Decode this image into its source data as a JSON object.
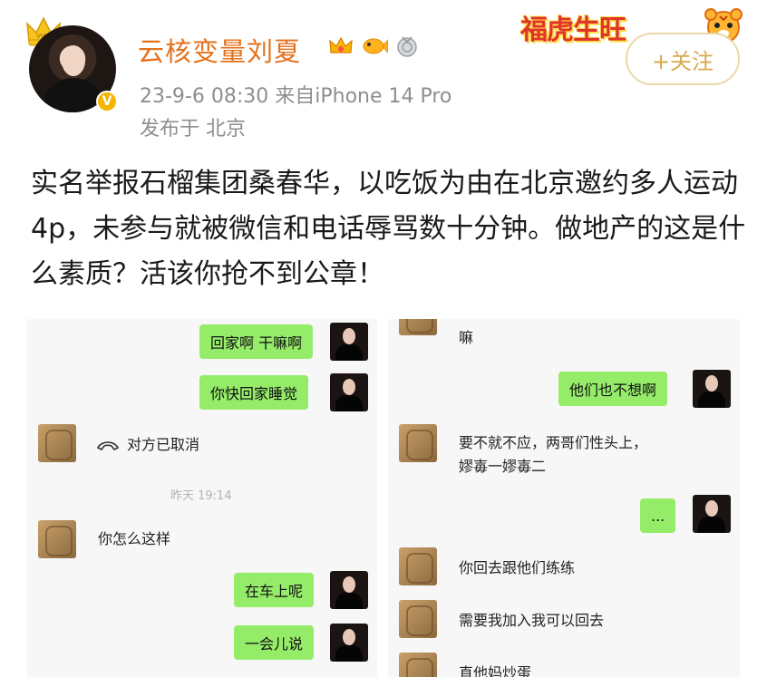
{
  "post": {
    "username": "云核变量刘夏",
    "meta": "23-9-6 08:30  来自iPhone 14 Pro",
    "location": "发布于 北京",
    "follow_label": "+关注",
    "decoration_text": "福虎生旺",
    "text": "实名举报石榴集团桑春华，以吃饭为由在北京邀约多人运动4p，未参与就被微信和电话辱骂数十分钟。做地产的这是什么素质？活该你抢不到公章！",
    "verified_badge": "V"
  },
  "chat_left": {
    "messages": [
      {
        "side": "self",
        "text": "回家啊 干嘛啊"
      },
      {
        "side": "self",
        "text": "你快回家睡觉"
      },
      {
        "side": "other",
        "text": "对方已取消",
        "icon": "phone-hangup-icon"
      },
      {
        "side": "system",
        "text": "昨天 19:14"
      },
      {
        "side": "other",
        "text": "你怎么这样"
      },
      {
        "side": "self",
        "text": "在车上呢"
      },
      {
        "side": "self",
        "text": "一会儿说"
      }
    ]
  },
  "chat_right": {
    "messages": [
      {
        "side": "other",
        "text": "嘛"
      },
      {
        "side": "self",
        "text": "他们也不想啊"
      },
      {
        "side": "other",
        "text": "要不就不应，两哥们性头上，",
        "line2": "嫪毐一嫪毐二"
      },
      {
        "side": "self",
        "text": "..."
      },
      {
        "side": "other",
        "text": "你回去跟他们练练"
      },
      {
        "side": "other",
        "text": "需要我加入我可以回去"
      },
      {
        "side": "other",
        "text": "直他妈炒蛋"
      }
    ]
  },
  "colors": {
    "username": "#e4711c",
    "meta": "#8e8e8e",
    "follow_border": "#ead8a6",
    "follow_text": "#d9a84e",
    "wechat_green": "#95ec69",
    "vip_gold": "#f5b400"
  }
}
